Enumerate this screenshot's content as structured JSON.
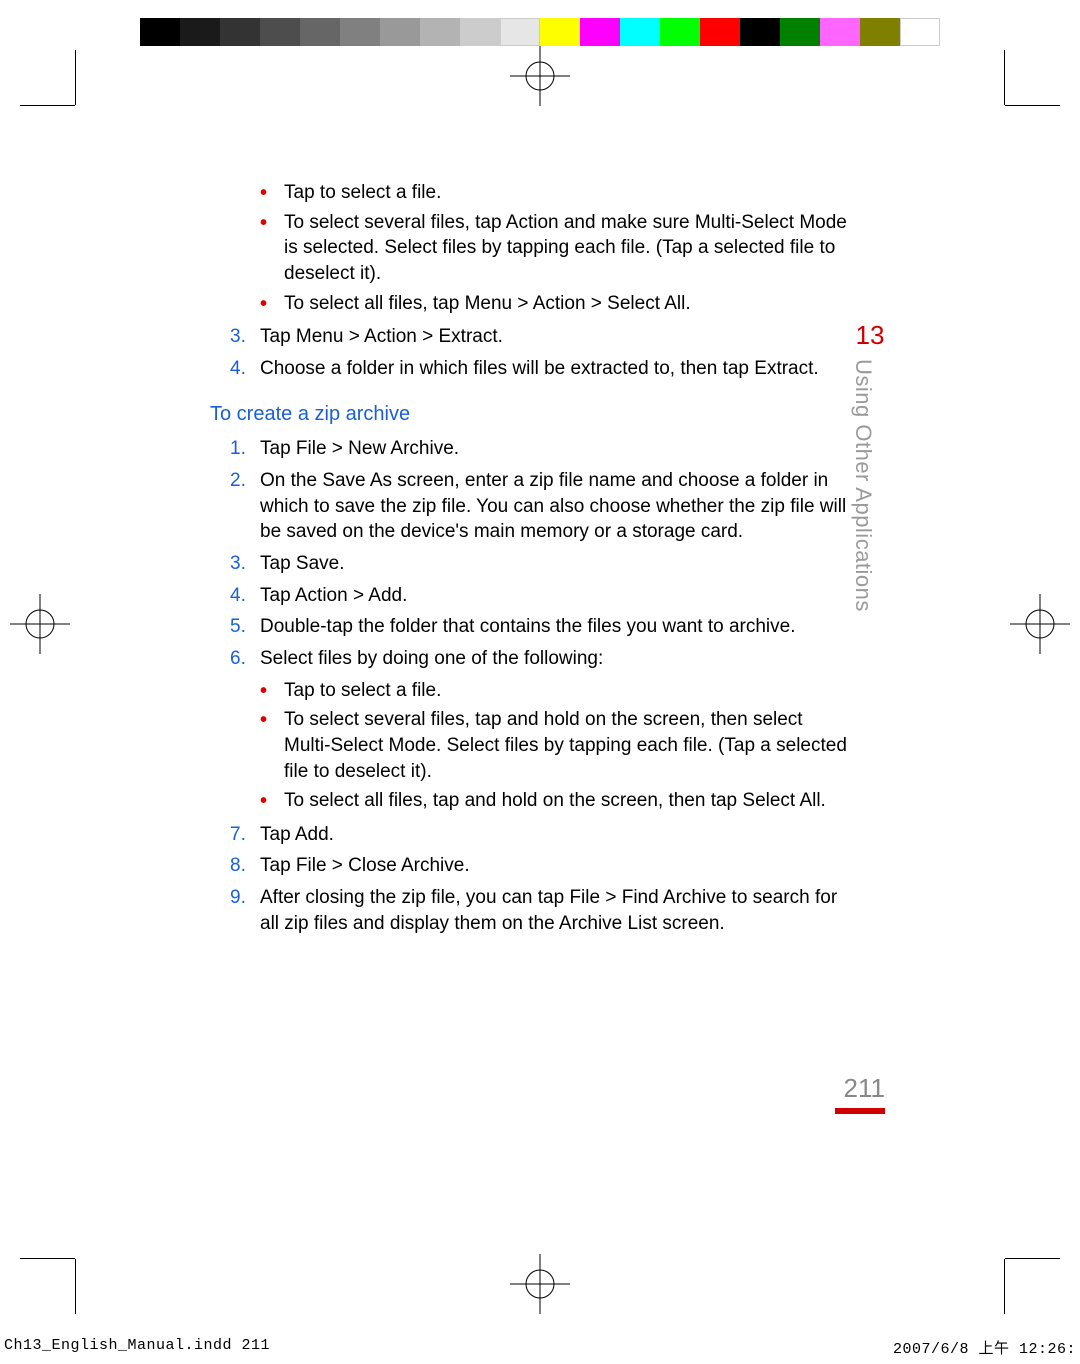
{
  "chapter_number": "13",
  "chapter_title": "Using Other Applications",
  "page_number": "211",
  "intro_bullets": [
    "Tap to select a file.",
    "To select several files, tap Action and make sure Multi-Select Mode is selected. Select files by tapping each file. (Tap a selected file to deselect it).",
    "To select all files, tap Menu > Action > Select All."
  ],
  "intro_steps": [
    {
      "n": "3.",
      "text": "Tap Menu > Action > Extract."
    },
    {
      "n": "4.",
      "text": "Choose a folder in which files will be extracted to, then tap Extract."
    }
  ],
  "section_heading": "To create a zip archive",
  "steps": [
    {
      "n": "1.",
      "text": "Tap File > New Archive."
    },
    {
      "n": "2.",
      "text": "On the Save As screen, enter a zip file name and choose a folder in which to save the zip file. You can also choose whether the zip file will be saved on the device's main memory or a storage card."
    },
    {
      "n": "3.",
      "text": "Tap Save."
    },
    {
      "n": "4.",
      "text": "Tap Action > Add."
    },
    {
      "n": "5.",
      "text": "Double-tap the folder that contains the files you want to archive."
    },
    {
      "n": "6.",
      "text": "Select files by doing one of the following:"
    }
  ],
  "sub_bullets": [
    "Tap to select a file.",
    "To select several files, tap and hold on the screen, then select Multi-Select Mode. Select files by tapping each file. (Tap a selected file to deselect it).",
    "To select all files, tap and hold on the screen, then tap Select All."
  ],
  "steps_after": [
    {
      "n": "7.",
      "text": "Tap Add."
    },
    {
      "n": "8.",
      "text": "Tap File > Close Archive."
    },
    {
      "n": "9.",
      "text": "After closing the zip file, you can tap File > Find Archive to search for all zip files and display them on the Archive List screen."
    }
  ],
  "footer_left": "Ch13_English_Manual.indd   211",
  "footer_right": "2007/6/8   上午 12:26:",
  "colorbar_greys": [
    "#000000",
    "#1a1a1a",
    "#333333",
    "#4d4d4d",
    "#666666",
    "#808080",
    "#999999",
    "#b3b3b3",
    "#cccccc",
    "#e6e6e6"
  ],
  "colorbar_colors": [
    "#ffff00",
    "#ff00ff",
    "#00ffff",
    "#00ff00",
    "#ff0000",
    "#000000",
    "#008000",
    "#ff66ff",
    "#808000",
    "#ffffff"
  ]
}
